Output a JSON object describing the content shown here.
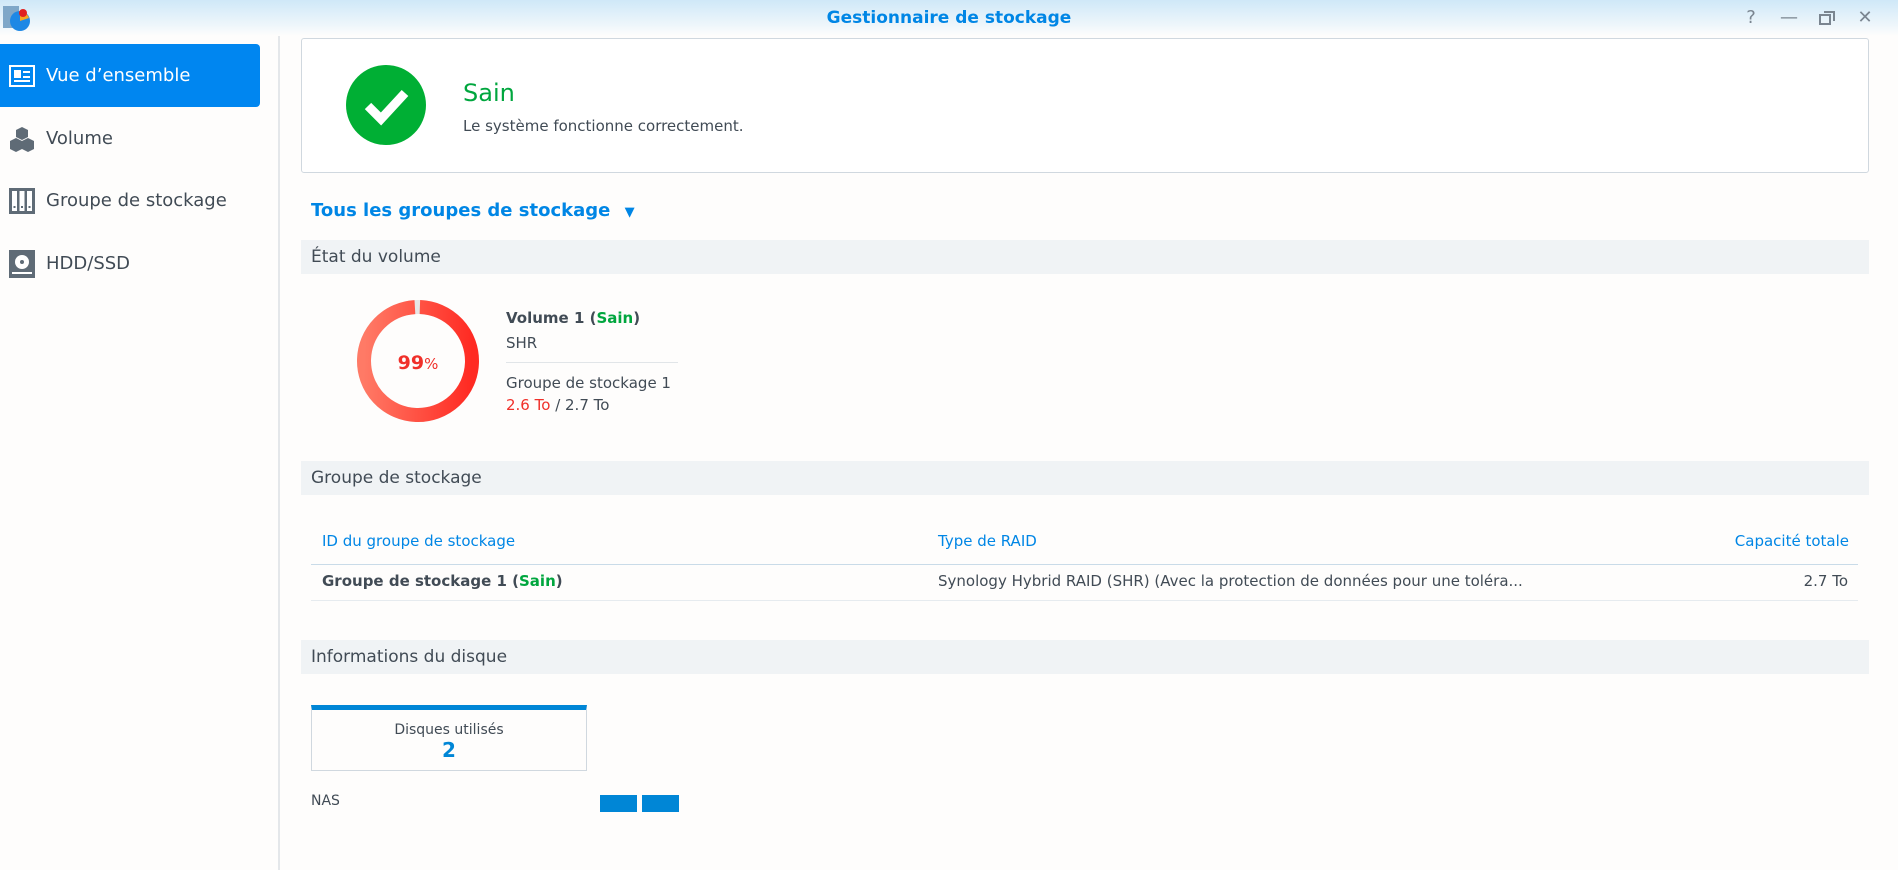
{
  "window": {
    "title": "Gestionnaire de stockage",
    "buttons": [
      "help",
      "minimize",
      "restore",
      "close"
    ]
  },
  "sidebar": {
    "items": [
      {
        "label": "Vue d’ensemble",
        "icon": "overview-icon",
        "active": true
      },
      {
        "label": "Volume",
        "icon": "volume-cubes-icon"
      },
      {
        "label": "Groupe de stockage",
        "icon": "storage-pool-icon"
      },
      {
        "label": "HDD/SSD",
        "icon": "hdd-icon"
      }
    ]
  },
  "status": {
    "title": "Sain",
    "message": "Le système fonctionne correctement.",
    "color": "#00a63e"
  },
  "filter": {
    "label": "Tous les groupes de stockage"
  },
  "volume_section": {
    "title": "État du volume",
    "volume": {
      "name": "Volume 1 (",
      "status": "Sain",
      "close": ")",
      "type": "SHR",
      "pool": "Groupe de stockage 1",
      "used": "2.6 To",
      "sep": " / ",
      "total": "2.7 To",
      "usage_percent": 99,
      "usage_label": "99",
      "pct": "%"
    }
  },
  "pool_section": {
    "title": "Groupe de stockage",
    "columns": [
      "ID du groupe de stockage",
      "Type de RAID",
      "Capacité totale"
    ],
    "rows": [
      {
        "name": "Groupe de stockage 1 (",
        "status": "Sain",
        "close": ")",
        "raid": "Synology Hybrid RAID (SHR) (Avec la protection de données pour une toléra...",
        "capacity": "2.7 To"
      }
    ]
  },
  "disk_section": {
    "title": "Informations du disque",
    "used_label": "Disques utilisés",
    "used_count": "2",
    "device": "NAS",
    "disks": 2
  }
}
